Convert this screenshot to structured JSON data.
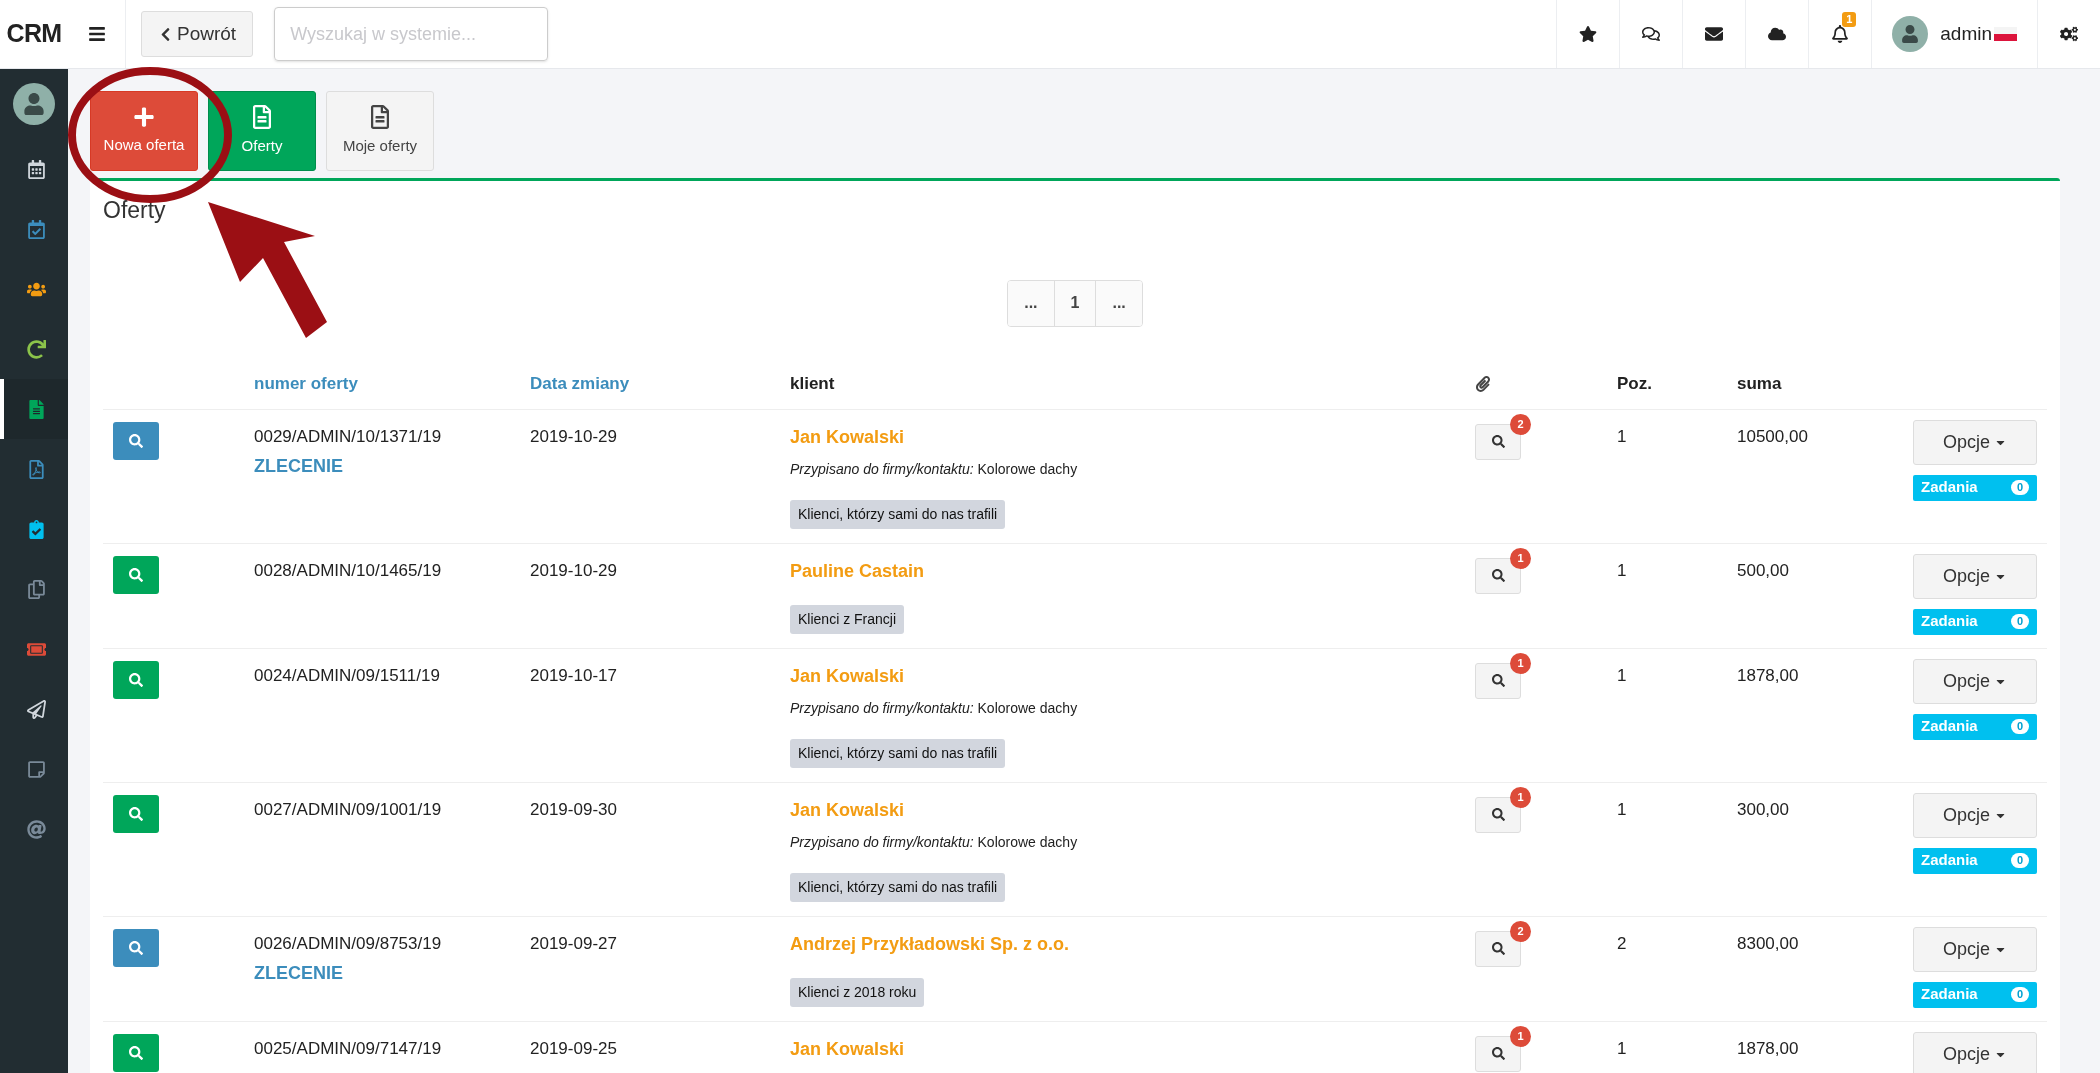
{
  "brand": "CRM",
  "topbar": {
    "back_button": "Powrót",
    "search": {
      "placeholder": "Wyszukaj w systemie..."
    },
    "notification_count": "1",
    "user": "admin"
  },
  "sidebar": {
    "items": [
      {
        "kind": "calendar",
        "color": "#d0d6dc",
        "selected": false
      },
      {
        "kind": "tasks",
        "color": "#3c8dbc",
        "selected": false
      },
      {
        "kind": "users",
        "color": "#f39c12",
        "selected": false
      },
      {
        "kind": "refresh",
        "color": "#8bc34a",
        "selected": false
      },
      {
        "kind": "document",
        "color": "#00a65a",
        "selected": true
      },
      {
        "kind": "pdf",
        "color": "#3c8dbc",
        "selected": false
      },
      {
        "kind": "clipboard",
        "color": "#00c0ef",
        "selected": false
      },
      {
        "kind": "copy",
        "color": "#7a8a99",
        "selected": false
      },
      {
        "kind": "ticket",
        "color": "#dd4b39",
        "selected": false
      },
      {
        "kind": "send",
        "color": "#d0d6dc",
        "selected": false
      },
      {
        "kind": "note",
        "color": "#7a8a99",
        "selected": false
      },
      {
        "kind": "at",
        "color": "#7a8a99",
        "selected": false
      }
    ]
  },
  "toolbar": [
    {
      "label": "Nowa oferta",
      "kind": "add"
    },
    {
      "label": "Oferty",
      "kind": "active"
    },
    {
      "label": "Moje oferty",
      "kind": "plain"
    }
  ],
  "panel": {
    "title": "Oferty",
    "pagination": [
      "...",
      "1",
      "..."
    ]
  },
  "table": {
    "columns": [
      {
        "label": "numer oferty",
        "kind": "link"
      },
      {
        "label": "Data zmiany",
        "kind": "link"
      },
      {
        "label": "klient",
        "kind": "plain"
      },
      {
        "kind": "attachment"
      },
      {
        "label": "Poz.",
        "kind": "plain"
      },
      {
        "label": "suma",
        "kind": "plain"
      }
    ],
    "rows": [
      {
        "kind": "order",
        "number": "0029/ADMIN/10/1371/19",
        "tag": "ZLECENIE",
        "date": "2019-10-29",
        "client": "Jan Kowalski",
        "assigned_label": "Przypisano do firmy/kontaktu:",
        "assigned_to": "Kolorowe dachy",
        "group": "Klienci, którzy sami do nas trafili",
        "attachments": "2",
        "positions": "1",
        "sum": "10500,00",
        "options": "Opcje",
        "tasks_label": "Zadania",
        "tasks_count": "0"
      },
      {
        "kind": "offer",
        "number": "0028/ADMIN/10/1465/19",
        "date": "2019-10-29",
        "client": "Pauline Castain",
        "group": "Klienci z Francji",
        "attachments": "1",
        "positions": "1",
        "sum": "500,00",
        "options": "Opcje",
        "tasks_label": "Zadania",
        "tasks_count": "0"
      },
      {
        "kind": "offer",
        "number": "0024/ADMIN/09/1511/19",
        "date": "2019-10-17",
        "client": "Jan Kowalski",
        "assigned_label": "Przypisano do firmy/kontaktu:",
        "assigned_to": "Kolorowe dachy",
        "group": "Klienci, którzy sami do nas trafili",
        "attachments": "1",
        "positions": "1",
        "sum": "1878,00",
        "options": "Opcje",
        "tasks_label": "Zadania",
        "tasks_count": "0"
      },
      {
        "kind": "offer",
        "number": "0027/ADMIN/09/1001/19",
        "date": "2019-09-30",
        "client": "Jan Kowalski",
        "assigned_label": "Przypisano do firmy/kontaktu:",
        "assigned_to": "Kolorowe dachy",
        "group": "Klienci, którzy sami do nas trafili",
        "attachments": "1",
        "positions": "1",
        "sum": "300,00",
        "options": "Opcje",
        "tasks_label": "Zadania",
        "tasks_count": "0"
      },
      {
        "kind": "order",
        "number": "0026/ADMIN/09/8753/19",
        "tag": "ZLECENIE",
        "date": "2019-09-27",
        "client": "Andrzej Przykładowski Sp. z o.o.",
        "group": "Klienci z 2018 roku",
        "attachments": "2",
        "positions": "2",
        "sum": "8300,00",
        "options": "Opcje",
        "tasks_label": "Zadania",
        "tasks_count": "0"
      },
      {
        "kind": "offer",
        "number": "0025/ADMIN/09/7147/19",
        "date": "2019-09-25",
        "client": "Jan Kowalski",
        "attachments": "1",
        "positions": "1",
        "sum": "1878,00",
        "options": "Opcje"
      }
    ]
  }
}
